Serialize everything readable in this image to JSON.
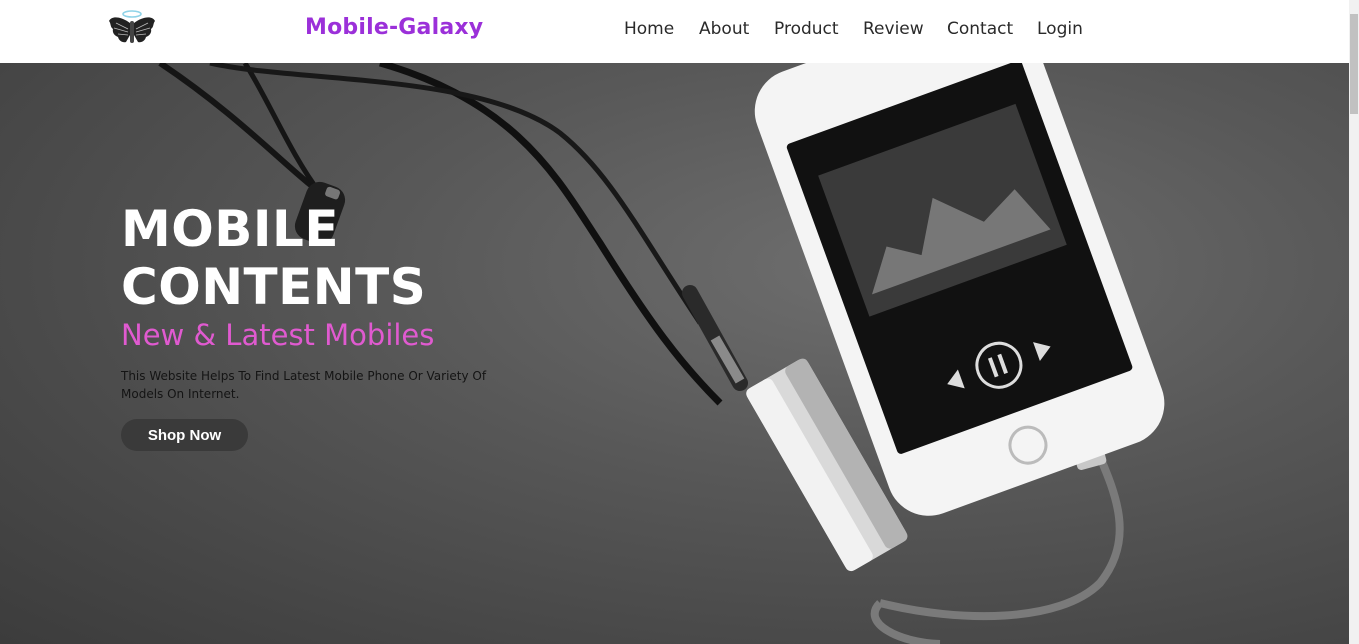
{
  "header": {
    "brand": "Mobile-Galaxy",
    "logo_icon": "angel-wings-halo-icon",
    "nav": [
      {
        "label": "Home"
      },
      {
        "label": "About"
      },
      {
        "label": "Product"
      },
      {
        "label": "Review"
      },
      {
        "label": "Contact"
      },
      {
        "label": "Login"
      }
    ]
  },
  "hero": {
    "title_line1": "MOBILE",
    "title_line2": "CONTENTS",
    "subtitle": "New & Latest Mobiles",
    "description": "This Website Helps To Find Latest Mobile Phone Or Variety Of Models On Internet.",
    "cta_label": "Shop Now",
    "image": "smartphone-with-earphones-and-dac-on-dark-surface"
  },
  "colors": {
    "brand": "#9b30d9",
    "subtitle": "#e05ad0",
    "button_bg": "#3a3a3a",
    "hero_bg": "#555555"
  }
}
